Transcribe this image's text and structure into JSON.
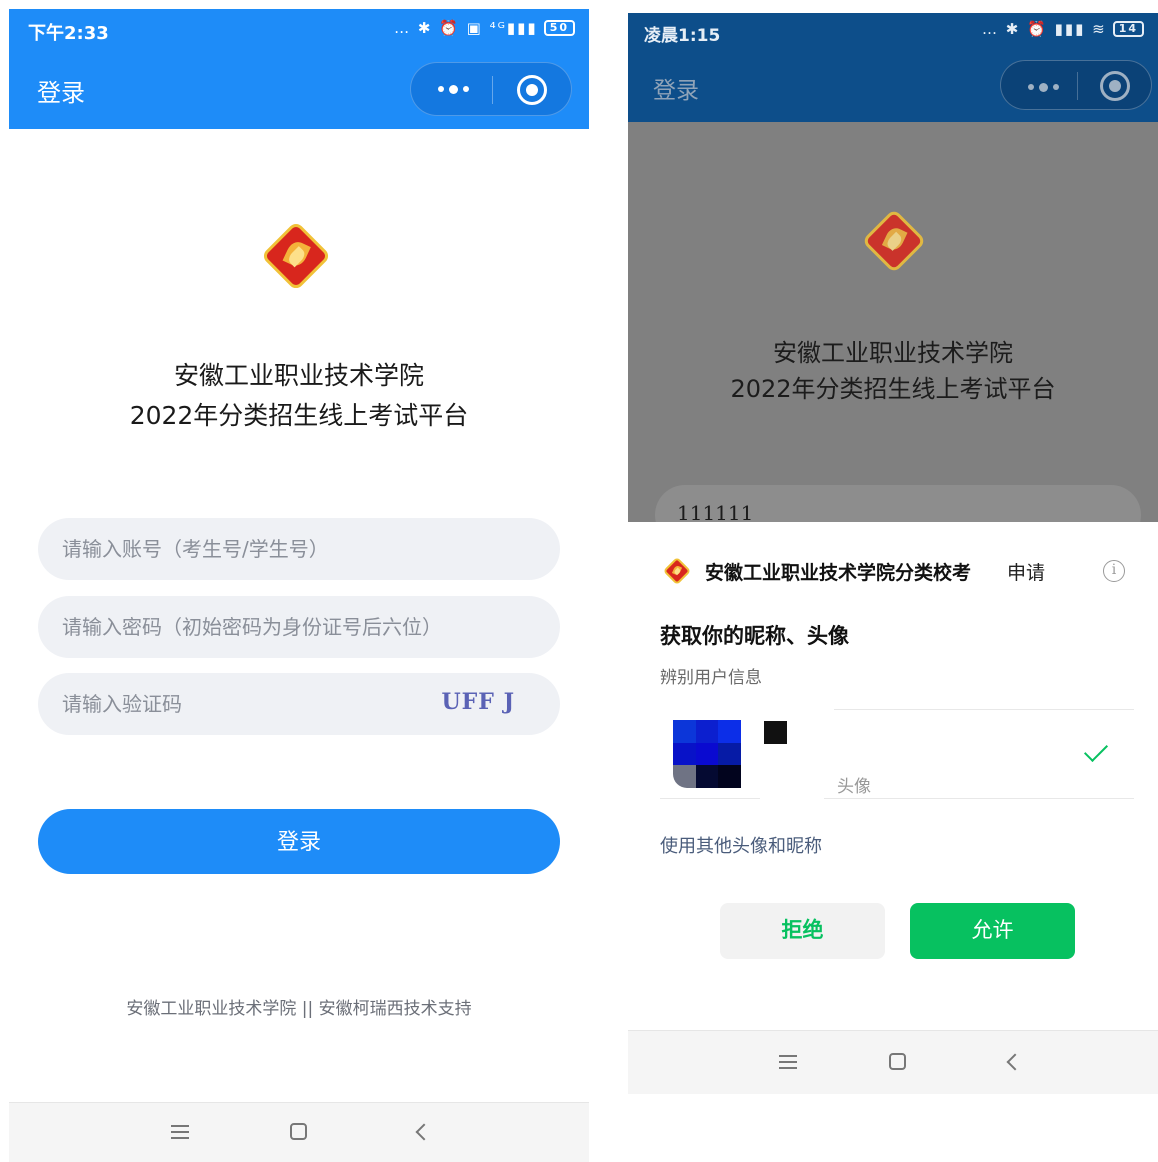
{
  "left": {
    "status": {
      "time": "下午2:33",
      "icons": "… ✱ ⏰ ▣ ⁴ᴳ▮▮▮",
      "battery": "50"
    },
    "nav": {
      "title": "登录"
    },
    "school": {
      "name": "安徽工业职业技术学院",
      "platform": "2022年分类招生线上考试平台"
    },
    "form": {
      "account_placeholder": "请输入账号（考生号/学生号）",
      "password_placeholder": "请输入密码（初始密码为身份证号后六位）",
      "captcha_placeholder": "请输入验证码",
      "captcha_code": "UFF J"
    },
    "login_button": "登录",
    "footer": "安徽工业职业技术学院 || 安徽柯瑞西技术支持"
  },
  "right": {
    "status": {
      "time": "凌晨1:15",
      "icons": "… ✱ ⏰ ▮▮▮ ≋",
      "battery": "14"
    },
    "nav": {
      "title": "登录"
    },
    "school": {
      "name": "安徽工业职业技术学院",
      "platform": "2022年分类招生线上考试平台"
    },
    "account_value": "111111",
    "sheet": {
      "app_name": "安徽工业职业技术学院分类校考",
      "apply": "申请",
      "info_icon": "i",
      "heading": "获取你的昵称、头像",
      "subheading": "辨别用户信息",
      "avatar_label": "头像",
      "other_link": "使用其他头像和昵称",
      "deny": "拒绝",
      "allow": "允许"
    }
  },
  "colors": {
    "primary": "#1e8cf8",
    "wechat_green": "#07c160",
    "dim_header": "#0d4e8a"
  }
}
